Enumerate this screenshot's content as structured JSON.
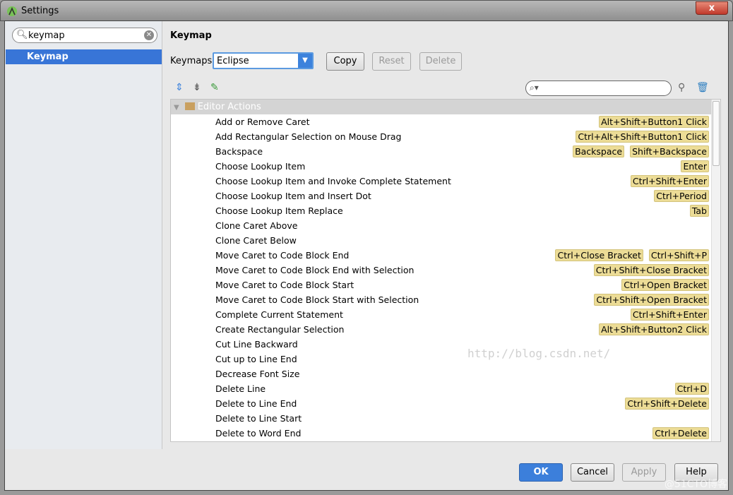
{
  "window": {
    "title": "Settings",
    "close": "x"
  },
  "sidebar": {
    "search_value": "keymap",
    "items": [
      {
        "label": "Keymap"
      }
    ]
  },
  "main": {
    "heading": "Keymap",
    "keymaps_label": "Keymaps:",
    "keymap_value": "Eclipse",
    "buttons": {
      "copy": "Copy",
      "reset": "Reset",
      "delete": "Delete"
    },
    "group": "Editor Actions",
    "actions": [
      {
        "name": "Add or Remove Caret",
        "keys": [
          "Alt+Shift+Button1 Click"
        ]
      },
      {
        "name": "Add Rectangular Selection on Mouse Drag",
        "keys": [
          "Ctrl+Alt+Shift+Button1 Click"
        ]
      },
      {
        "name": "Backspace",
        "keys": [
          "Backspace",
          "Shift+Backspace"
        ]
      },
      {
        "name": "Choose Lookup Item",
        "keys": [
          "Enter"
        ]
      },
      {
        "name": "Choose Lookup Item and Invoke Complete Statement",
        "keys": [
          "Ctrl+Shift+Enter"
        ]
      },
      {
        "name": "Choose Lookup Item and Insert Dot",
        "keys": [
          "Ctrl+Period"
        ]
      },
      {
        "name": "Choose Lookup Item Replace",
        "keys": [
          "Tab"
        ]
      },
      {
        "name": "Clone Caret Above",
        "keys": []
      },
      {
        "name": "Clone Caret Below",
        "keys": []
      },
      {
        "name": "Move Caret to Code Block End",
        "keys": [
          "Ctrl+Close Bracket",
          "Ctrl+Shift+P"
        ]
      },
      {
        "name": "Move Caret to Code Block End with Selection",
        "keys": [
          "Ctrl+Shift+Close Bracket"
        ]
      },
      {
        "name": "Move Caret to Code Block Start",
        "keys": [
          "Ctrl+Open Bracket"
        ]
      },
      {
        "name": "Move Caret to Code Block Start with Selection",
        "keys": [
          "Ctrl+Shift+Open Bracket"
        ]
      },
      {
        "name": "Complete Current Statement",
        "keys": [
          "Ctrl+Shift+Enter"
        ]
      },
      {
        "name": "Create Rectangular Selection",
        "keys": [
          "Alt+Shift+Button2 Click"
        ]
      },
      {
        "name": "Cut Line Backward",
        "keys": []
      },
      {
        "name": "Cut up to Line End",
        "keys": []
      },
      {
        "name": "Decrease Font Size",
        "keys": []
      },
      {
        "name": "Delete Line",
        "keys": [
          "Ctrl+D"
        ]
      },
      {
        "name": "Delete to Line End",
        "keys": [
          "Ctrl+Shift+Delete"
        ]
      },
      {
        "name": "Delete to Line Start",
        "keys": []
      },
      {
        "name": "Delete to Word End",
        "keys": [
          "Ctrl+Delete"
        ]
      }
    ]
  },
  "footer": {
    "ok": "OK",
    "cancel": "Cancel",
    "apply": "Apply",
    "help": "Help"
  },
  "watermarks": {
    "center": "http://blog.csdn.net/",
    "corner": "@51CTO博客"
  },
  "colors": {
    "accent": "#3875d7",
    "shortcut_bg": "#ecdc96"
  }
}
